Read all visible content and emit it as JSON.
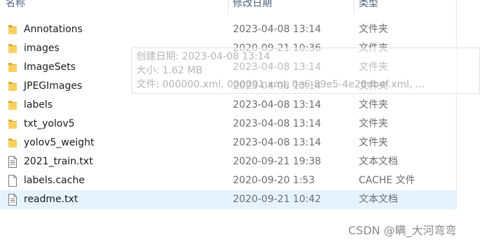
{
  "columns": {
    "name": "名称",
    "date_modified": "修改日期",
    "type": "类型"
  },
  "files": [
    {
      "name": "Annotations",
      "date": "2023-04-08 13:14",
      "type": "文件夹",
      "icon": "folder-icon"
    },
    {
      "name": "images",
      "date": "2020-09-21 10:36",
      "type": "文件夹",
      "icon": "folder-icon"
    },
    {
      "name": "ImageSets",
      "date": "2023-04-08 13:14",
      "type": "文件夹",
      "icon": "folder-icon"
    },
    {
      "name": "JPEGImages",
      "date": "2023-04-08 13:14",
      "type": "文件夹",
      "icon": "folder-icon"
    },
    {
      "name": "labels",
      "date": "2023-04-08 13:14",
      "type": "文件夹",
      "icon": "folder-icon"
    },
    {
      "name": "txt_yolov5",
      "date": "2023-04-08 13:14",
      "type": "文件夹",
      "icon": "folder-icon"
    },
    {
      "name": "yolov5_weight",
      "date": "2023-04-08 13:14",
      "type": "文件夹",
      "icon": "folder-icon"
    },
    {
      "name": "2021_train.txt",
      "date": "2020-09-21 19:38",
      "type": "文本文档",
      "icon": "text-file-icon"
    },
    {
      "name": "labels.cache",
      "date": "2020-09-20 1:53",
      "type": "CACHE 文件",
      "icon": "file-icon"
    },
    {
      "name": "readme.txt",
      "date": "2020-09-21 10:42",
      "type": "文本文档",
      "icon": "text-file-icon",
      "selected": true
    }
  ],
  "tooltip": {
    "created": "创建日期: 2023-04-08 13:14",
    "size": "大小: 1.62 MB",
    "files": "文件: 000000.xml, 000001.xml, 0e6-89e5-4e28dbef.xml, ..."
  },
  "watermark": "CSDN @瞒_大河弯弯",
  "colors": {
    "selected_row": "#e5f3ff",
    "folder": "#f4c542",
    "header_text": "#4c607a"
  }
}
